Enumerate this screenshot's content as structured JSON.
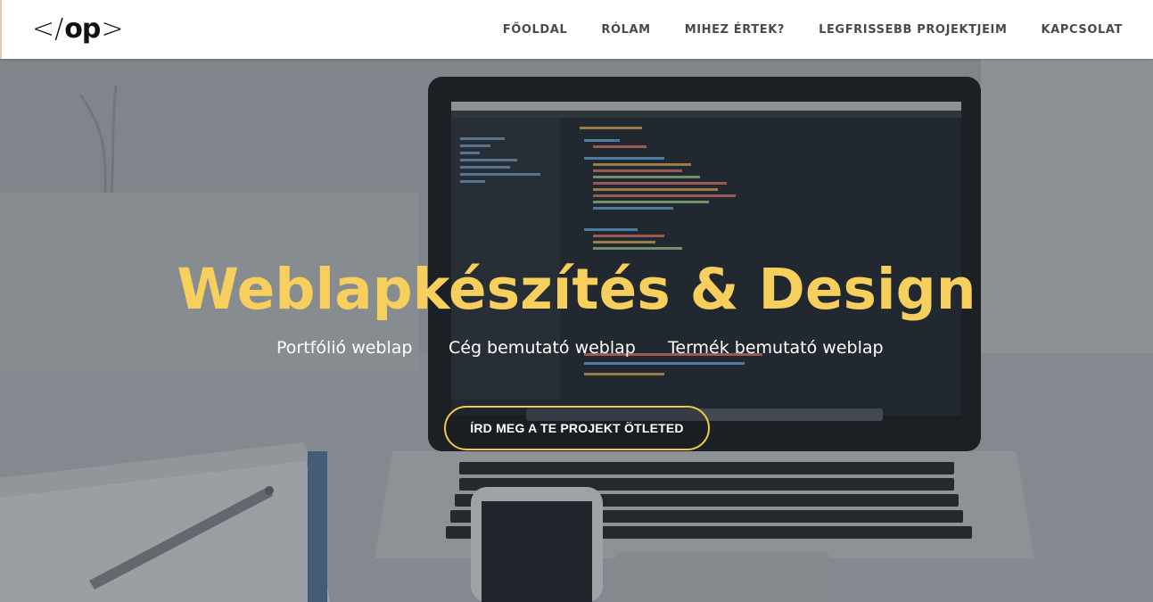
{
  "logo": {
    "open": "</",
    "text": "op",
    "close": ">"
  },
  "nav": {
    "items": [
      {
        "label": "FŐOLDAL"
      },
      {
        "label": "RÓLAM"
      },
      {
        "label": "MIHEZ ÉRTEK?"
      },
      {
        "label": "LEGFRISSEBB PROJEKTJEIM"
      },
      {
        "label": "KAPCSOLAT"
      }
    ]
  },
  "hero": {
    "title": "Weblapkészítés & Design",
    "services": [
      "Portfólió weblap",
      "Cég bemutató weblap",
      "Termék bemutató weblap"
    ],
    "cta_label": "ÍRD MEG A TE PROJEKT ÖTLETED"
  },
  "colors": {
    "accent": "#f7cf5c",
    "cta_border": "#f2c94c",
    "nav_text": "#4a4a4a"
  },
  "icons": {
    "background": "laptop-desk-photo"
  }
}
